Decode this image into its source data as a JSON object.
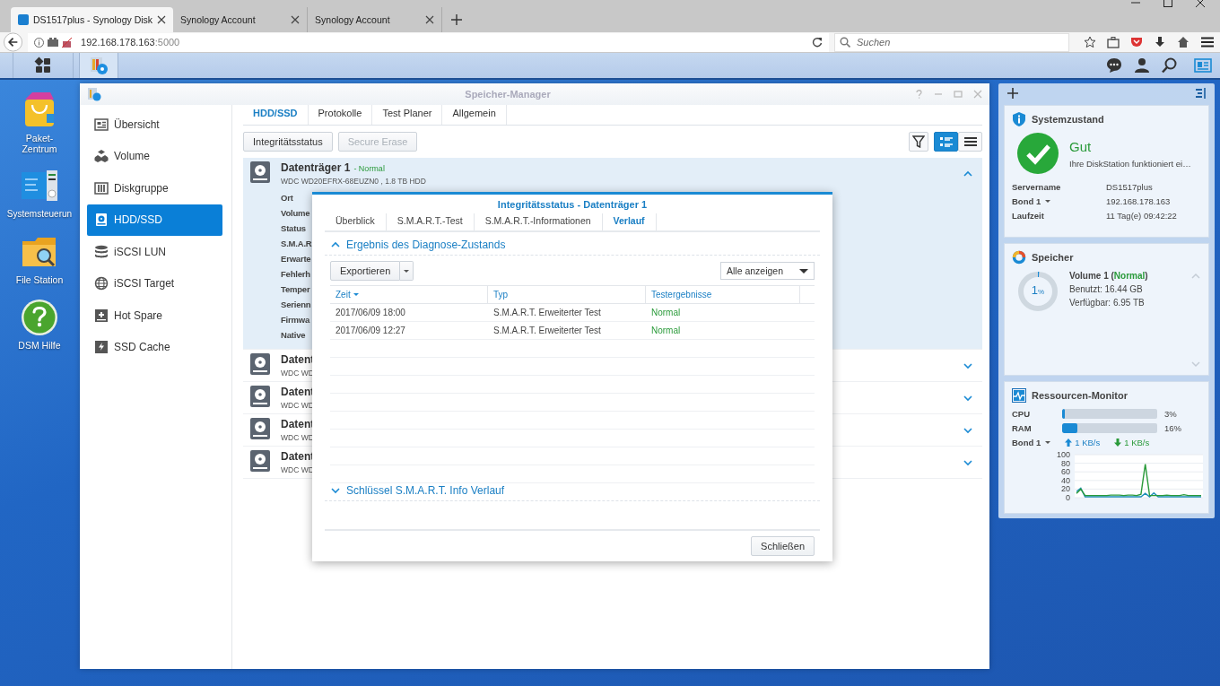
{
  "browser": {
    "tabs": [
      {
        "title": "DS1517plus - Synology Disk",
        "selected": true
      },
      {
        "title": "Synology Account",
        "selected": false
      },
      {
        "title": "Synology Account",
        "selected": false
      }
    ],
    "address": {
      "host": "192.168.178.163",
      "port": ":5000"
    },
    "search": {
      "placeholder": "Suchen"
    }
  },
  "desktop_icons": [
    {
      "label": "Paket-Zentrum"
    },
    {
      "label": "Systemsteuerun"
    },
    {
      "label": "File Station"
    },
    {
      "label": "DSM Hilfe"
    }
  ],
  "window": {
    "title": "Speicher-Manager",
    "sidebar": [
      {
        "label": "Übersicht",
        "selected": false
      },
      {
        "label": "Volume",
        "selected": false
      },
      {
        "label": "Diskgruppe",
        "selected": false
      },
      {
        "label": "HDD/SSD",
        "selected": true
      },
      {
        "label": "iSCSI LUN",
        "selected": false
      },
      {
        "label": "iSCSI Target",
        "selected": false
      },
      {
        "label": "Hot Spare",
        "selected": false
      },
      {
        "label": "SSD Cache",
        "selected": false
      }
    ],
    "tabs": [
      {
        "label": "HDD/SSD",
        "selected": true
      },
      {
        "label": "Protokolle",
        "selected": false
      },
      {
        "label": "Test Planer",
        "selected": false
      },
      {
        "label": "Allgemein",
        "selected": false
      }
    ],
    "actions": [
      {
        "label": "Integritätsstatus",
        "disabled": false
      },
      {
        "label": "Secure Erase",
        "disabled": true
      }
    ],
    "views": [
      {
        "selected": true
      },
      {
        "selected": false
      }
    ],
    "disks": [
      {
        "name": "Datenträger 1",
        "status": "- Normal",
        "model": "WDC WD20EFRX-68EUZN0 , 1.8 TB HDD",
        "expanded": true,
        "details": [
          "Ort",
          "Volume",
          "Status",
          "S.M.A.R",
          "Erwarte",
          "Fehlerh",
          "Temper",
          "Serienn",
          "Firmwa",
          "Native"
        ]
      },
      {
        "name": "Datent",
        "model": "WDC WD",
        "expanded": false
      },
      {
        "name": "Datent",
        "model": "WDC WD",
        "expanded": false
      },
      {
        "name": "Datent",
        "model": "WDC WD",
        "expanded": false
      },
      {
        "name": "Datent",
        "model": "WDC WD",
        "expanded": false
      }
    ]
  },
  "dialog": {
    "title": "Integritätsstatus - Datenträger 1",
    "tabs": [
      {
        "label": "Überblick",
        "selected": false
      },
      {
        "label": "S.M.A.R.T.-Test",
        "selected": false
      },
      {
        "label": "S.M.A.R.T.-Informationen",
        "selected": false
      },
      {
        "label": "Verlauf",
        "selected": true
      }
    ],
    "sections": [
      {
        "title": "Ergebnis des Diagnose-Zustands",
        "expanded": true
      },
      {
        "title": "Schlüssel S.M.A.R.T. Info Verlauf",
        "expanded": false
      }
    ],
    "export_button": "Exportieren",
    "filter": {
      "value": "Alle anzeigen"
    },
    "table": {
      "columns": [
        "Zeit",
        "Typ",
        "Testergebnisse"
      ],
      "rows": [
        [
          "2017/06/09 18:00",
          "S.M.A.R.T. Erweiterter Test",
          "Normal"
        ],
        [
          "2017/06/09 12:27",
          "S.M.A.R.T. Erweiterter Test",
          "Normal"
        ]
      ]
    },
    "close_button": "Schließen"
  },
  "widgets": {
    "health": {
      "title": "Systemzustand",
      "status": "Gut",
      "message": "Ihre DiskStation funktioniert ei…",
      "rows": [
        {
          "label": "Servername",
          "value": "DS1517plus",
          "dropdown": false
        },
        {
          "label": "Bond 1",
          "value": "192.168.178.163",
          "dropdown": true
        },
        {
          "label": "Laufzeit",
          "value": "11 Tag(e) 09:42:22",
          "dropdown": false
        }
      ]
    },
    "storage": {
      "title": "Speicher",
      "usage": "1",
      "unit": "%",
      "level": 0.01,
      "volume": "Volume 1 (**Normal**)",
      "used": "Benutzt: 16.44 GB",
      "free": "Verfügbar: 6.95 TB"
    },
    "monitor": {
      "title": "Ressourcen-Monitor",
      "meters": [
        {
          "name": "CPU",
          "level": 0.03,
          "reading": "3%"
        },
        {
          "name": "RAM",
          "level": 0.16,
          "reading": "16%"
        }
      ],
      "network": {
        "interface": "Bond 1",
        "upload": "1 KB/s",
        "download": "1 KB/s"
      },
      "chart_data": {
        "type": "line",
        "ylim": [
          0,
          100
        ],
        "yticks": [
          0,
          20,
          40,
          60,
          80,
          100
        ],
        "grid": true,
        "series": [
          {
            "color": "#1c8fb8",
            "values": [
              14,
              22,
              2,
              2,
              2,
              2,
              2,
              2,
              2,
              2,
              2,
              2,
              2,
              2,
              2,
              2,
              10,
              2,
              11,
              2,
              2,
              2,
              2,
              2,
              2,
              2,
              2,
              2,
              2,
              2
            ]
          },
          {
            "color": "#2a9a3a",
            "values": [
              10,
              20,
              5,
              5,
              5,
              5,
              5,
              5,
              6,
              6,
              6,
              5,
              6,
              6,
              5,
              8,
              78,
              5,
              5,
              5,
              5,
              6,
              5,
              5,
              5,
              7,
              5,
              5,
              5,
              5
            ]
          }
        ]
      }
    }
  }
}
